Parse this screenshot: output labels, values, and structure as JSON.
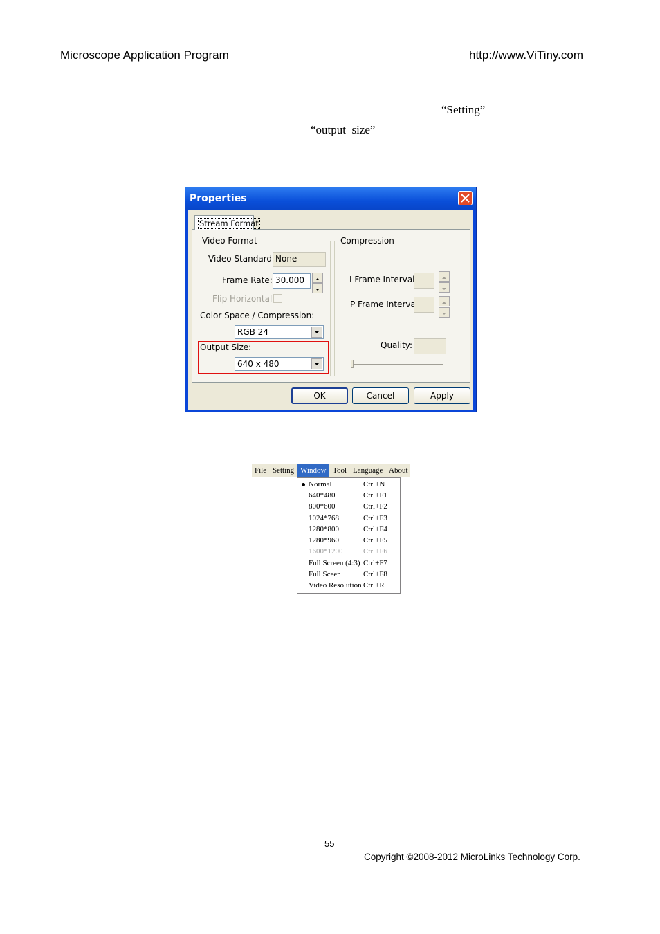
{
  "header": {
    "left": "Microscope Application Program",
    "right": "http://www.ViTiny.com"
  },
  "body_text": {
    "setting": "“Setting”",
    "output_size": "“output  size”"
  },
  "dialog": {
    "title": "Properties",
    "tab": "Stream Format",
    "video_format": {
      "group_label": "Video Format",
      "video_standard_label": "Video Standard:",
      "video_standard_value": "None",
      "frame_rate_label": "Frame Rate:",
      "frame_rate_value": "30.000",
      "flip_horizontal_label": "Flip Horizontal:",
      "color_space_label": "Color Space / Compression:",
      "color_space_value": "RGB 24",
      "output_size_label": "Output Size:",
      "output_size_value": "640 x 480"
    },
    "compression": {
      "group_label": "Compression",
      "i_frame_label": "I Frame Interval:",
      "p_frame_label": "P Frame Interval:",
      "quality_label": "Quality:"
    },
    "buttons": {
      "ok": "OK",
      "cancel": "Cancel",
      "apply": "Apply"
    },
    "highlight_color": "#e01010"
  },
  "menubar": {
    "items": [
      "File",
      "Setting",
      "Window",
      "Tool",
      "Language",
      "About"
    ],
    "active": "Window",
    "active_color": "#316ac5"
  },
  "window_menu": {
    "items": [
      {
        "label": "Normal",
        "shortcut": "Ctrl+N",
        "checked": true
      },
      {
        "label": "640*480",
        "shortcut": "Ctrl+F1"
      },
      {
        "label": "800*600",
        "shortcut": "Ctrl+F2"
      },
      {
        "label": "1024*768",
        "shortcut": "Ctrl+F3"
      },
      {
        "label": "1280*800",
        "shortcut": "Ctrl+F4"
      },
      {
        "label": "1280*960",
        "shortcut": "Ctrl+F5"
      },
      {
        "label": "1600*1200",
        "shortcut": "Ctrl+F6",
        "disabled": true
      },
      {
        "label": "Full Screen (4:3)",
        "shortcut": "Ctrl+F7"
      },
      {
        "label": "Full Sceen",
        "shortcut": "Ctrl+F8"
      },
      {
        "label": "Video Resolution",
        "shortcut": "Ctrl+R"
      }
    ]
  },
  "footer": {
    "page_number": "55",
    "copyright": "Copyright ©2008-2012 MicroLinks Technology Corp."
  }
}
